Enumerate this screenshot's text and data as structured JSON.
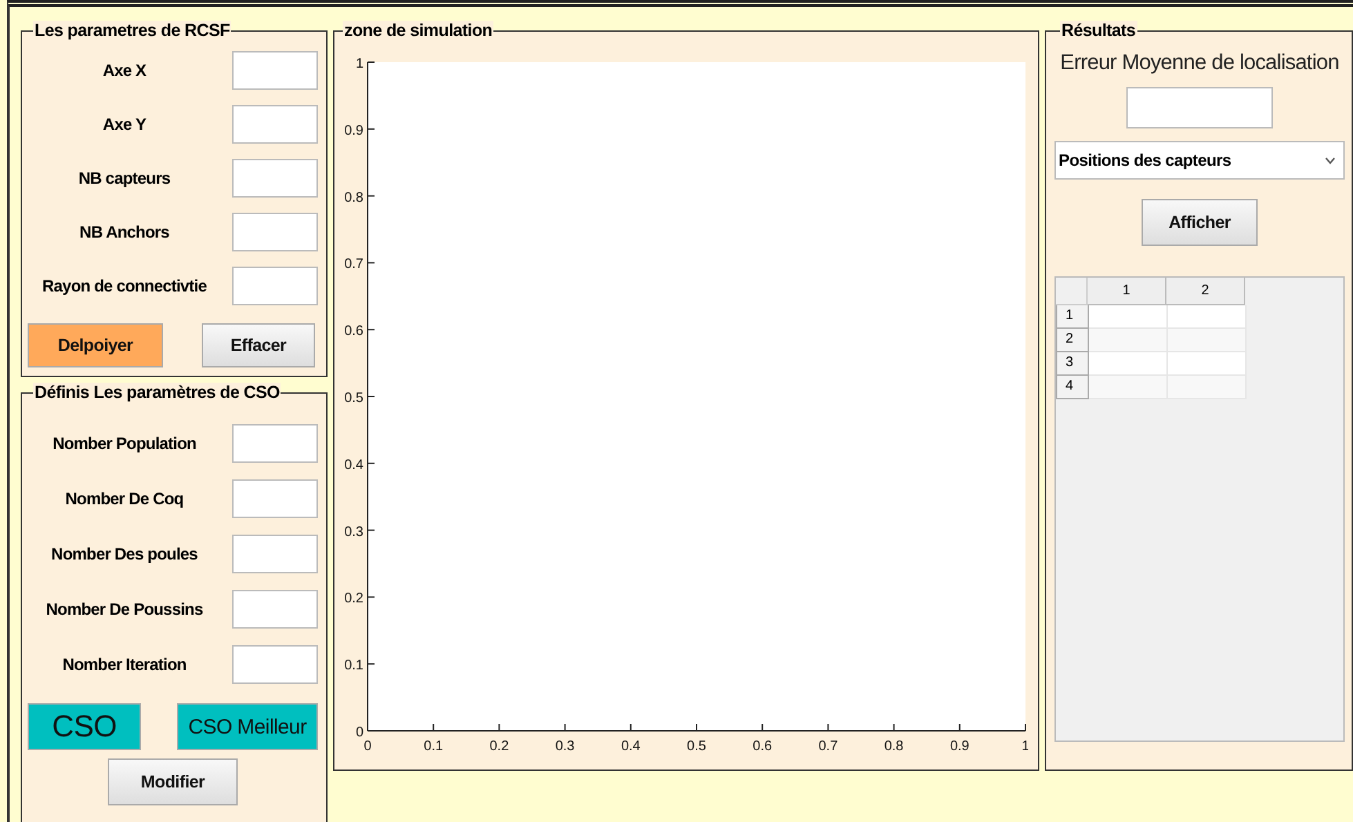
{
  "rcsf_panel": {
    "title": "Les parametres de RCSF",
    "fields": [
      {
        "label": "Axe X"
      },
      {
        "label": "Axe Y"
      },
      {
        "label": "NB capteurs"
      },
      {
        "label": "NB Anchors"
      },
      {
        "label": "Rayon de connectivtie"
      }
    ],
    "buttons": [
      {
        "label": "Delpoiyer",
        "kind": "primary"
      },
      {
        "label": "Effacer",
        "kind": "plain"
      }
    ]
  },
  "cso_panel": {
    "title": "Définis Les paramètres de CSO",
    "fields": [
      {
        "label": "Nomber Population"
      },
      {
        "label": "Nomber De Coq"
      },
      {
        "label": "Nomber Des poules"
      },
      {
        "label": "Nomber De Poussins"
      },
      {
        "label": "Nomber Iteration"
      }
    ],
    "buttons": [
      {
        "label": "CSO",
        "kind": "accent"
      },
      {
        "label": "CSO Meilleur",
        "kind": "accent"
      },
      {
        "label": "Modifier",
        "kind": "plain"
      }
    ]
  },
  "simulation_panel": {
    "title": "zone de simulation",
    "chart_data": {
      "type": "line",
      "xlim": [
        0,
        1
      ],
      "ylim": [
        0,
        1
      ],
      "xticks": [
        0,
        0.1,
        0.2,
        0.3,
        0.4,
        0.5,
        0.6,
        0.7,
        0.8,
        0.9,
        1
      ],
      "yticks": [
        0,
        0.1,
        0.2,
        0.3,
        0.4,
        0.5,
        0.6,
        0.7,
        0.8,
        0.9,
        1
      ]
    }
  },
  "results_panel": {
    "title": "Résultats",
    "error_label": "Erreur Moyenne de localisation",
    "dropdown": {
      "value": "Positions des capteurs"
    },
    "button": "Afficher",
    "table": {
      "columns": [
        "1",
        "2"
      ],
      "rows": [
        "1",
        "2",
        "3",
        "4"
      ]
    }
  }
}
